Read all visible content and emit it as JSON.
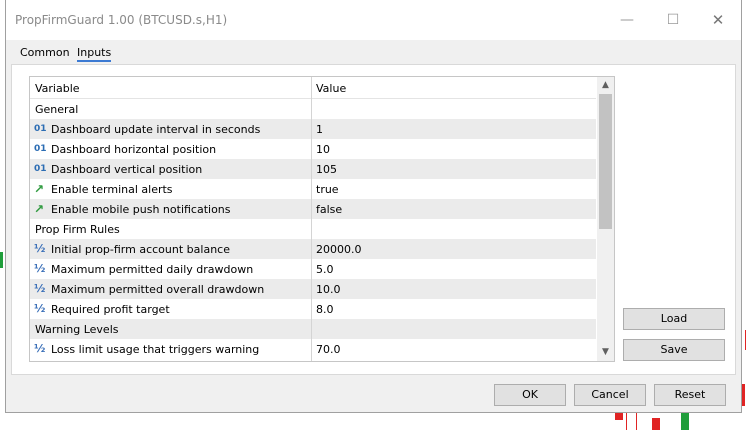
{
  "window": {
    "title": "PropFirmGuard 1.00 (BTCUSD.s,H1)"
  },
  "titlebar": {
    "minimize_glyph": "—",
    "maximize_glyph": "☐",
    "close_glyph": "✕"
  },
  "tabs": [
    {
      "label": "Common",
      "active": false
    },
    {
      "label": "Inputs",
      "active": true
    }
  ],
  "grid": {
    "headers": {
      "variable": "Variable",
      "value": "Value"
    },
    "rows": [
      {
        "type": "section",
        "variable": "General",
        "value": ""
      },
      {
        "type": "int",
        "icon": "int-icon",
        "variable": "Dashboard update interval in seconds",
        "value": "1"
      },
      {
        "type": "int",
        "icon": "int-icon",
        "variable": "Dashboard horizontal position",
        "value": "10"
      },
      {
        "type": "int",
        "icon": "int-icon",
        "variable": "Dashboard vertical position",
        "value": "105"
      },
      {
        "type": "bool",
        "icon": "bool-icon",
        "variable": "Enable terminal alerts",
        "value": "true"
      },
      {
        "type": "bool",
        "icon": "bool-icon",
        "variable": "Enable mobile push notifications",
        "value": "false"
      },
      {
        "type": "section",
        "variable": "Prop Firm Rules",
        "value": ""
      },
      {
        "type": "double",
        "icon": "double-icon",
        "variable": "Initial prop-firm account balance",
        "value": "20000.0"
      },
      {
        "type": "double",
        "icon": "double-icon",
        "variable": "Maximum permitted daily drawdown",
        "value": "5.0"
      },
      {
        "type": "double",
        "icon": "double-icon",
        "variable": "Maximum permitted overall drawdown",
        "value": "10.0"
      },
      {
        "type": "double",
        "icon": "double-icon",
        "variable": "Required profit target",
        "value": "8.0"
      },
      {
        "type": "section",
        "variable": "Warning Levels",
        "value": ""
      },
      {
        "type": "double",
        "icon": "double-icon",
        "variable": "Loss limit usage that triggers warning",
        "value": "70.0"
      }
    ],
    "icon_glyphs": {
      "int": "01",
      "bool": "↗",
      "double": "½"
    }
  },
  "side_buttons": {
    "load": "Load",
    "save": "Save"
  },
  "footer_buttons": {
    "ok": "OK",
    "cancel": "Cancel",
    "reset": "Reset"
  },
  "colors": {
    "accent": "#3c7ad3",
    "bull": "#1f9d3a",
    "bear": "#e02424"
  }
}
